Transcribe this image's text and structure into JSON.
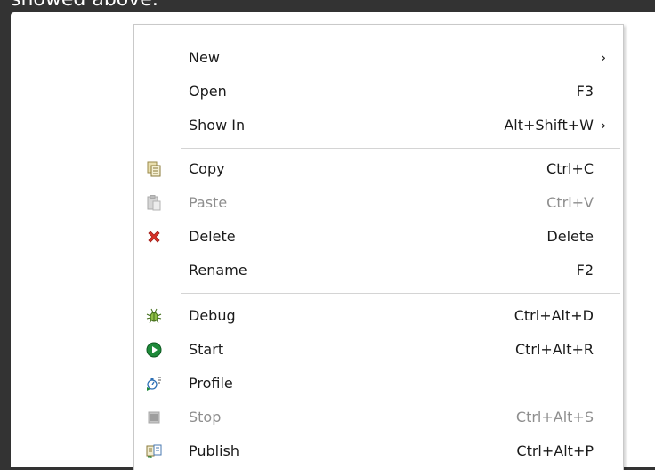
{
  "header": {
    "text": "showed above."
  },
  "menu": {
    "items": [
      {
        "label": "New",
        "shortcut": "",
        "submenu": true,
        "icon": "",
        "disabled": false
      },
      {
        "label": "Open",
        "shortcut": "F3",
        "submenu": false,
        "icon": "",
        "disabled": false
      },
      {
        "label": "Show In",
        "shortcut": "Alt+Shift+W",
        "submenu": true,
        "icon": "",
        "disabled": false
      },
      {
        "label": "Copy",
        "shortcut": "Ctrl+C",
        "submenu": false,
        "icon": "copy-icon",
        "disabled": false
      },
      {
        "label": "Paste",
        "shortcut": "Ctrl+V",
        "submenu": false,
        "icon": "paste-icon",
        "disabled": true
      },
      {
        "label": "Delete",
        "shortcut": "Delete",
        "submenu": false,
        "icon": "delete-icon",
        "disabled": false
      },
      {
        "label": "Rename",
        "shortcut": "F2",
        "submenu": false,
        "icon": "",
        "disabled": false
      },
      {
        "label": "Debug",
        "shortcut": "Ctrl+Alt+D",
        "submenu": false,
        "icon": "debug-icon",
        "disabled": false
      },
      {
        "label": "Start",
        "shortcut": "Ctrl+Alt+R",
        "submenu": false,
        "icon": "start-icon",
        "disabled": false
      },
      {
        "label": "Profile",
        "shortcut": "",
        "submenu": false,
        "icon": "profile-icon",
        "disabled": false
      },
      {
        "label": "Stop",
        "shortcut": "Ctrl+Alt+S",
        "submenu": false,
        "icon": "stop-icon",
        "disabled": true
      },
      {
        "label": "Publish",
        "shortcut": "Ctrl+Alt+P",
        "submenu": false,
        "icon": "publish-icon",
        "disabled": false
      }
    ],
    "submenu_arrow": "›",
    "colors": {
      "enabled_text": "#1a1a1a",
      "disabled_text": "#8e8e8e",
      "delete_red": "#d9342b",
      "start_green": "#1e8a3a"
    }
  }
}
